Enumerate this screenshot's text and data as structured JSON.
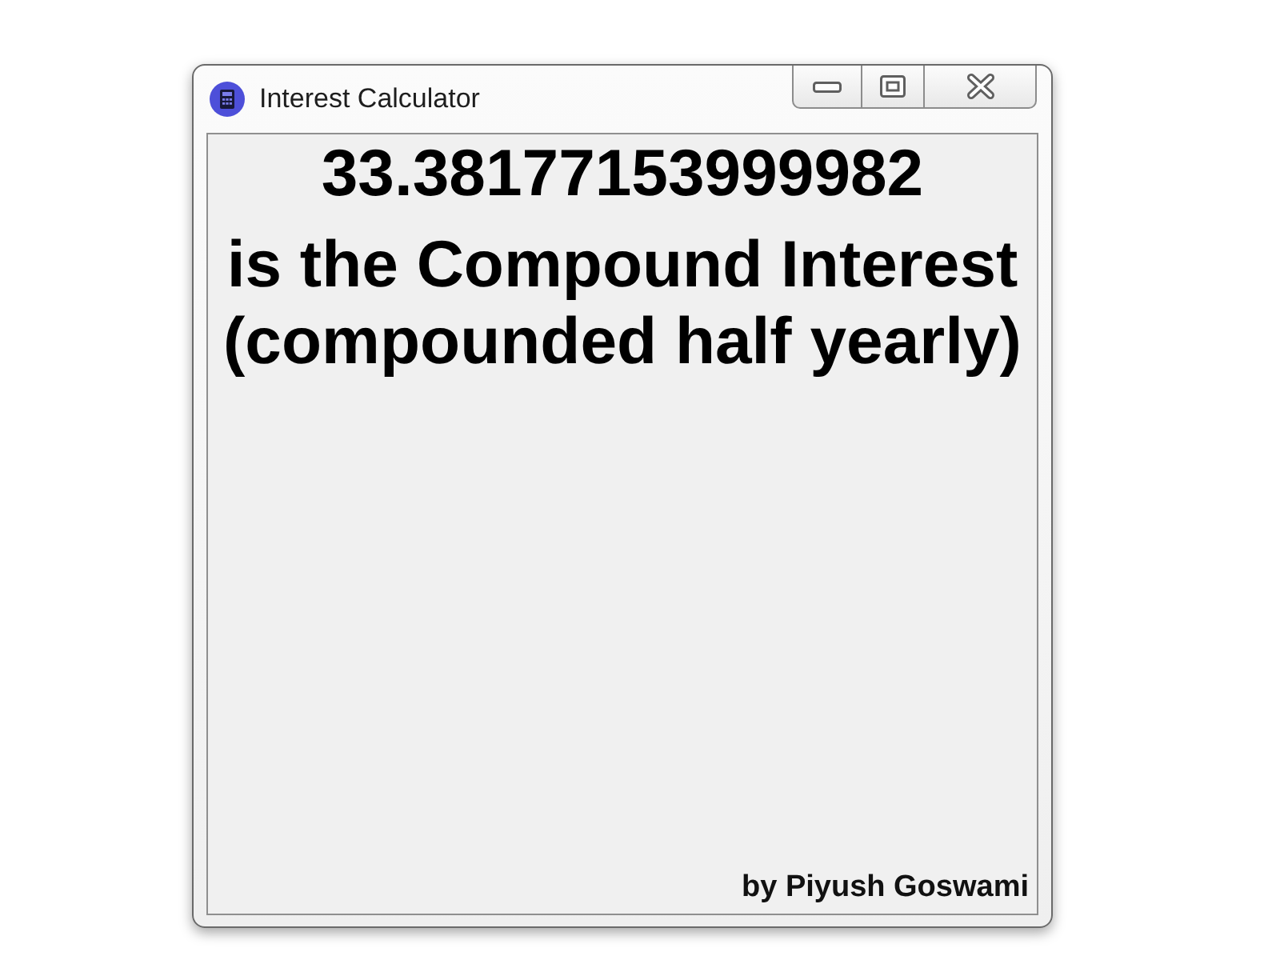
{
  "window": {
    "title": "Interest Calculator",
    "controls": [
      {
        "kind": "minimize"
      },
      {
        "kind": "maximize"
      },
      {
        "kind": "close"
      }
    ]
  },
  "result": {
    "value": "33.38177153999982",
    "message": "is the Compound Interest (compounded half yearly)"
  },
  "footer": {
    "credit": "by Piyush Goswami"
  }
}
